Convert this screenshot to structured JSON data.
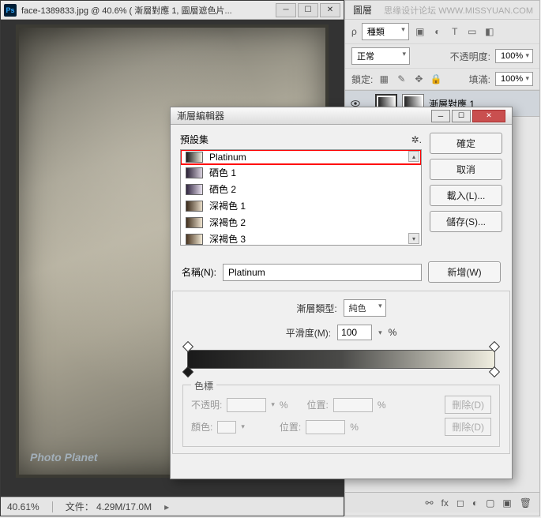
{
  "main": {
    "title": "face-1389833.jpg @ 40.6% ( 漸層對應 1, 圖層遮色片...",
    "zoom": "40.61%",
    "file_size": "文件：  4.29M/17.0M"
  },
  "layers_panel": {
    "title": "圖層",
    "watermark": "思缘设计论坛   WWW.MISSYUAN.COM",
    "kind_label": "種類",
    "blend_mode": "正常",
    "opacity_label": "不透明度:",
    "opacity_value": "100%",
    "lock_label": "鎖定:",
    "fill_label": "填滿:",
    "fill_value": "100%",
    "layer_name": "漸層對應 1"
  },
  "dialog": {
    "title": "漸層編輯器",
    "presets_label": "預設集",
    "buttons": {
      "ok": "確定",
      "cancel": "取消",
      "load": "載入(L)...",
      "save": "儲存(S)...",
      "new": "新增(W)"
    },
    "presets": [
      {
        "label": "Platinum",
        "g": "linear-gradient(90deg,#1a1a1a,#f0eee0)"
      },
      {
        "label": "硒色 1",
        "g": "linear-gradient(90deg,#2a2035,#d8d0dd)"
      },
      {
        "label": "硒色 2",
        "g": "linear-gradient(90deg,#302540,#e8e0ee)"
      },
      {
        "label": "深褐色 1",
        "g": "linear-gradient(90deg,#3a2a1a,#e8dcc8)"
      },
      {
        "label": "深褐色 2",
        "g": "linear-gradient(90deg,#402f1d,#efe4d0)"
      },
      {
        "label": "深褐色 3",
        "g": "linear-gradient(90deg,#4a3520,#f2e9d5)"
      }
    ],
    "name_label": "名稱(N):",
    "name_value": "Platinum",
    "grad_type_label": "漸層類型:",
    "grad_type_value": "純色",
    "smooth_label": "平滑度(M):",
    "smooth_value": "100",
    "smooth_unit": "%",
    "stops": {
      "legend": "色標",
      "opacity_label": "不透明:",
      "color_label": "顏色:",
      "position_label": "位置:",
      "delete_label": "刪除(D)",
      "percent": "%"
    }
  },
  "watermark_photo": "Photo Planet"
}
